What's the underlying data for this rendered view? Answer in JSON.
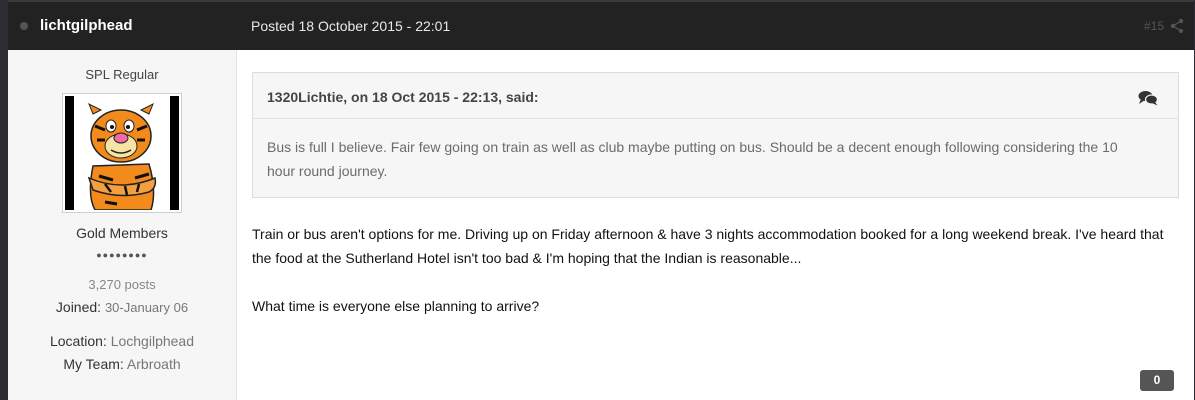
{
  "header": {
    "author": "lichtgilphead",
    "posted": "Posted 18 October 2015 - 22:01",
    "post_number": "#15"
  },
  "sidebar": {
    "member_title": "SPL Regular",
    "group": "Gold Members",
    "pips": "●●●●●●●●",
    "posts": "3,270 posts",
    "joined_label": "Joined:",
    "joined_value": "30-January 06",
    "location_label": "Location:",
    "location_value": "Lochgilphead",
    "team_label": "My Team:",
    "team_value": "Arbroath"
  },
  "quote": {
    "citation": "1320Lichtie, on 18 Oct 2015 - 22:13, said:",
    "body": "Bus is full I believe. Fair few going on train as well as club maybe putting on bus. Should be a decent enough following considering the 10 hour round journey."
  },
  "content": {
    "paragraph1": "Train or bus aren't options for me. Driving up on Friday afternoon & have 3 nights accommodation booked for a long weekend break. I've heard that the food at the Sutherland Hotel isn't too bad & I'm hoping that the Indian is reasonable...",
    "paragraph2": "What time is everyone else planning to arrive?"
  },
  "reputation": "0",
  "icons": {
    "share": "share-icon",
    "quote": "quote-bubbles-icon",
    "status": "online-status-icon",
    "avatar": "tigger-avatar"
  },
  "colors": {
    "header_bg": "#222222",
    "sidebar_bg": "#f6f6f6",
    "quote_bg": "#f6f6f6",
    "reputation_bg": "#555555"
  }
}
